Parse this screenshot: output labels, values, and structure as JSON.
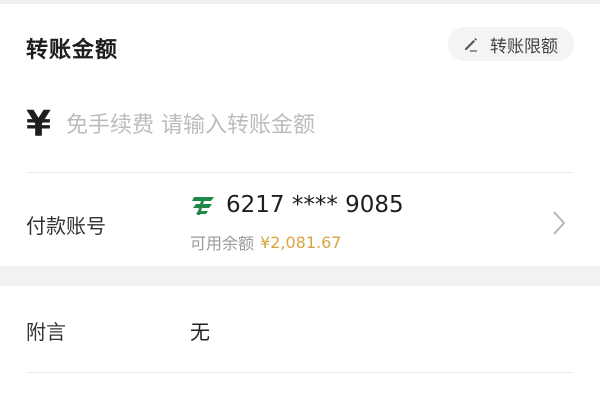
{
  "transfer": {
    "section_title": "转账金额",
    "limit_button_label": "转账限额",
    "currency_symbol": "¥",
    "amount_placeholder": "免手续费 请输入转账金额"
  },
  "payer": {
    "label": "付款账号",
    "bank_logo_icon": "postal-savings-bank-logo-icon",
    "card_number": "6217 **** 9085",
    "balance_label": "可用余额",
    "balance_value": "¥2,081.67"
  },
  "remark": {
    "label": "附言",
    "value": "无"
  },
  "colors": {
    "brand_green": "#1f8a48",
    "balance_gold": "#d9a441",
    "placeholder_gray": "#bcbcbc",
    "page_background": "#f2f2f2"
  }
}
